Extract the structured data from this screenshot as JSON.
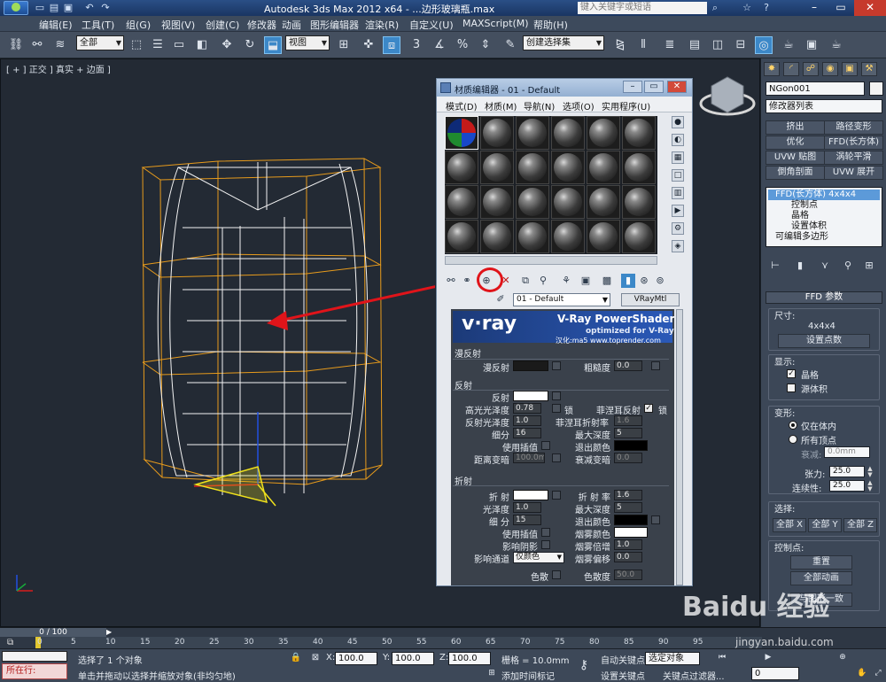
{
  "window": {
    "title": "Autodesk 3ds Max  2012 x64  - ...边形玻璃瓶.max",
    "search_placeholder": "键入关键字或短语"
  },
  "menu": [
    "编辑(E)",
    "工具(T)",
    "组(G)",
    "视图(V)",
    "创建(C)",
    "修改器",
    "动画",
    "图形编辑器",
    "渲染(R)",
    "自定义(U)",
    "MAXScript(M)",
    "帮助(H)"
  ],
  "toolbar": {
    "selection_filter": "全部",
    "ref_coord": "视图",
    "named_selection": "创建选择集"
  },
  "viewport": {
    "label": "[ + ] 正交 ] 真实 + 边面 ]"
  },
  "command_panel": {
    "object_name": "NGon001",
    "modifier_list": "修改器列表",
    "modifier_buttons": [
      "挤出",
      "路径变形",
      "优化",
      "FFD(长方体)",
      "UVW 贴图",
      "涡轮平滑",
      "倒角剖面",
      "UVW 展开"
    ],
    "stack": [
      {
        "label": "FFD(长方体) 4x4x4",
        "selected": true
      },
      {
        "label": "控制点",
        "selected": false
      },
      {
        "label": "晶格",
        "selected": false
      },
      {
        "label": "设置体积",
        "selected": false
      },
      {
        "label": "可编辑多边形",
        "selected": false
      }
    ],
    "rollout_title": "FFD 参数",
    "dimensions": {
      "label": "尺寸:",
      "value": "4x4x4",
      "button": "设置点数"
    },
    "display": {
      "label": "显示:",
      "lattice": "晶格",
      "source_volume": "源体积"
    },
    "deform": {
      "label": "变形:",
      "only_in_volume": "仅在体内",
      "all_vertices": "所有顶点",
      "falloff_label": "衰减:",
      "falloff_value": "0.0mm",
      "tension_label": "张力:",
      "tension_value": "25.0",
      "continuity_label": "连续性:",
      "continuity_value": "25.0"
    },
    "select": {
      "label": "选择:",
      "buttons": [
        "全部 X",
        "全部 Y",
        "全部 Z"
      ]
    },
    "control_points": {
      "label": "控制点:",
      "reset": "重置",
      "animate_all": "全部动画",
      "conform": "与图形一致"
    }
  },
  "material_editor": {
    "title": "材质编辑器 - 01 - Default",
    "menu": [
      "模式(D)",
      "材质(M)",
      "导航(N)",
      "选项(O)",
      "实用程序(U)"
    ],
    "material_name": "01 - Default",
    "material_type": "VRayMtl",
    "banner": {
      "logo": "v·ray",
      "title": "V-Ray PowerShader",
      "subtitle": "optimized for V-Ray",
      "credit": "汉化:ma5 www.toprender.com"
    },
    "diffuse": {
      "section": "漫反射",
      "diffuse_label": "漫反射",
      "diffuse_color": "#1a1a1a",
      "roughness_label": "粗糙度",
      "roughness_value": "0.0"
    },
    "reflection": {
      "section": "反射",
      "reflect_label": "反射",
      "reflect_color": "#ffffff",
      "hilight_gloss_label": "高光光泽度",
      "hilight_gloss_value": "0.78",
      "lock_label": "锁",
      "fresnel_label": "菲涅耳反射",
      "fresnel_checked": "✓",
      "fresnel_lock_label": "锁",
      "refl_gloss_label": "反射光泽度",
      "refl_gloss_value": "1.0",
      "fresnel_ior_label": "菲涅耳折射率",
      "fresnel_ior_value": "1.6",
      "subdivs_label": "细分",
      "subdivs_value": "16",
      "max_depth_label": "最大深度",
      "max_depth_value": "5",
      "use_interp_label": "使用插值",
      "exit_color_label": "退出颜色",
      "exit_color": "#000000",
      "dim_distance_label": "距离变暗",
      "dim_distance_value": "100.0mm",
      "dim_falloff_label": "衰减变暗",
      "dim_falloff_value": "0.0"
    },
    "refraction": {
      "section": "折射",
      "refract_label": "折 射",
      "refract_color": "#ffffff",
      "ior_label": "折 射 率",
      "ior_value": "1.6",
      "gloss_label": "光泽度",
      "gloss_value": "1.0",
      "max_depth_label": "最大深度",
      "max_depth_value": "5",
      "subdivs_label": "细 分",
      "subdivs_value": "15",
      "exit_color_label": "退出颜色",
      "exit_color": "#000000",
      "use_interp_label": "使用插值",
      "fog_color_label": "烟雾颜色",
      "fog_color": "#ffffff",
      "affect_shadows_label": "影响阴影",
      "fog_multiplier_label": "烟雾倍增",
      "fog_multiplier_value": "1.0",
      "affect_channels_label": "影响通道",
      "affect_channels_value": "仅颜色",
      "fog_bias_label": "烟雾偏移",
      "fog_bias_value": "0.0",
      "dispersion_label": "色散",
      "abbe_label": "色散度",
      "abbe_value": "50.0"
    }
  },
  "timeline": {
    "frame_display": "0 / 100",
    "ticks": [
      "0",
      "5",
      "10",
      "15",
      "20",
      "25",
      "30",
      "35",
      "40",
      "45",
      "50",
      "55",
      "60",
      "65",
      "70",
      "75",
      "80",
      "85",
      "90",
      "95"
    ]
  },
  "status": {
    "selection_info": "选择了 1 个对象",
    "prompt": "单击并拖动以选择并缩放对象(非均匀地)",
    "location_label": "所在行:",
    "x_label": "X:",
    "x_value": "100.0",
    "y_label": "Y:",
    "y_value": "100.0",
    "z_label": "Z:",
    "z_value": "100.0",
    "grid": "栅格 = 10.0mm",
    "add_time_tag": "添加时间标记",
    "auto_key": "自动关键点",
    "set_key": "设置关键点",
    "selected_object": "选定对象",
    "key_filters": "关键点过滤器...",
    "frame_value": "0"
  },
  "watermark": {
    "brand": "Baidu 经验",
    "url": "jingyan.baidu.com"
  }
}
